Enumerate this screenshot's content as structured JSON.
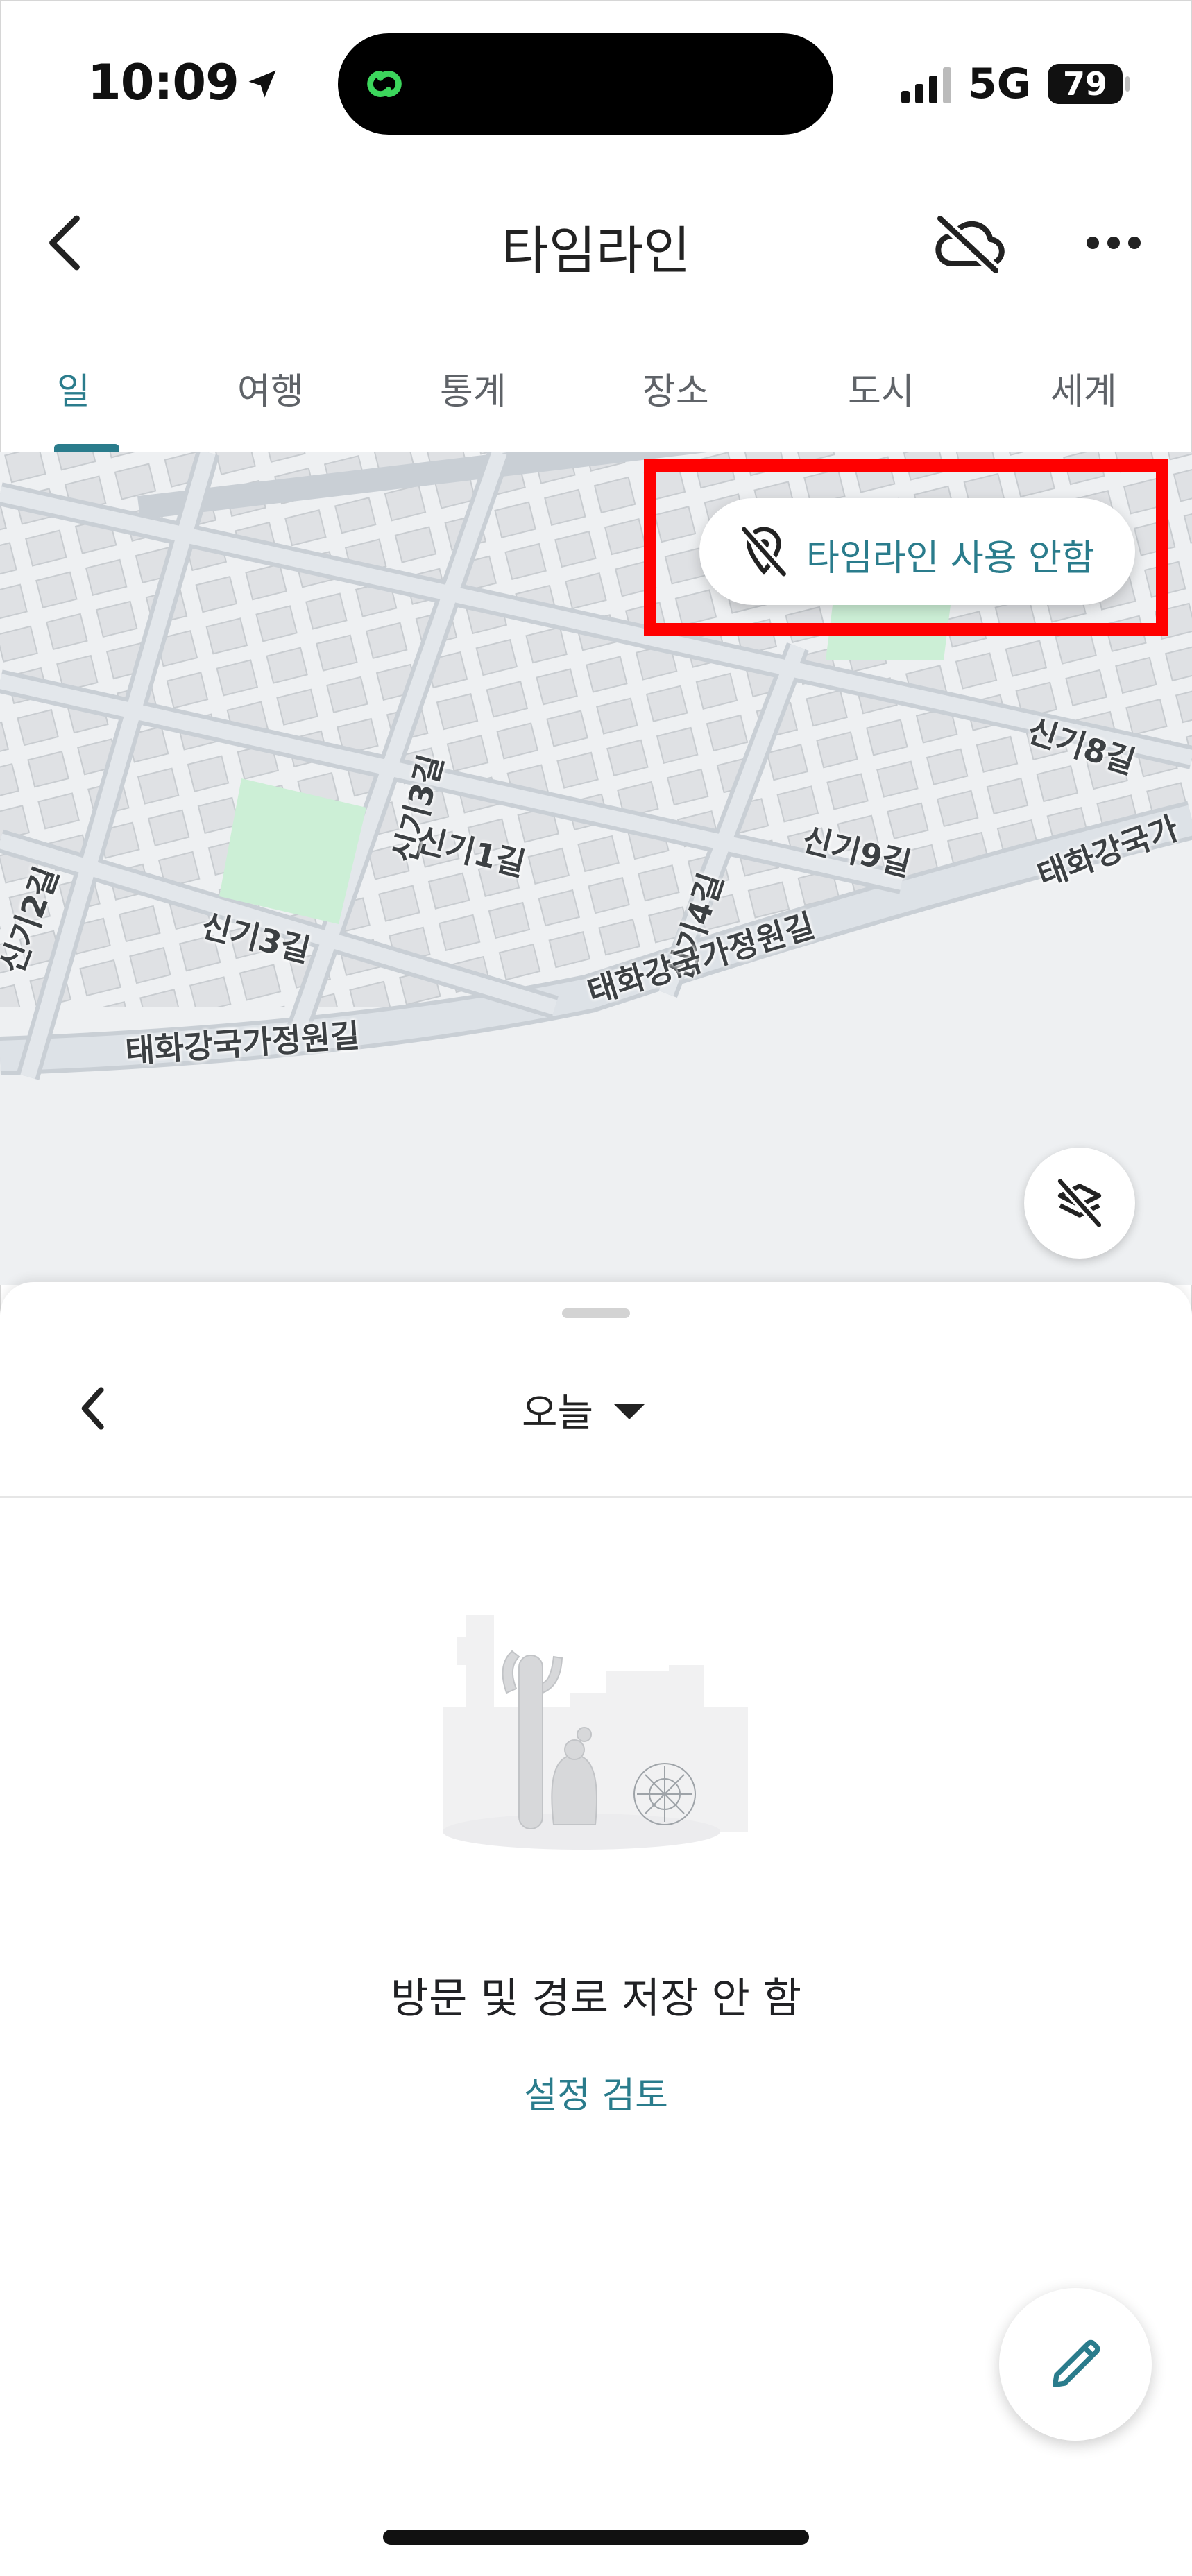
{
  "status_bar": {
    "time": "10:09",
    "network": "5G",
    "battery": "79"
  },
  "app_bar": {
    "title": "타임라인"
  },
  "tabs": [
    {
      "label": "일",
      "active": true
    },
    {
      "label": "여행",
      "active": false
    },
    {
      "label": "통계",
      "active": false
    },
    {
      "label": "장소",
      "active": false
    },
    {
      "label": "도시",
      "active": false
    },
    {
      "label": "세계",
      "active": false
    }
  ],
  "map": {
    "streets": [
      "신기3길",
      "신기1길",
      "신기4길",
      "신기8길",
      "신기9길",
      "신기2길",
      "신기3길",
      "태화강국가정원길",
      "태화강국가정원길",
      "태화강국가"
    ],
    "timeline_pill": "타임라인 사용 안함"
  },
  "sheet": {
    "day_label": "오늘",
    "empty_title": "방문 및 경로 저장 안 함",
    "review_link": "설정 검토"
  },
  "colors": {
    "accent": "#2a7c8c",
    "highlight": "#ff0000",
    "map_bg": "#eef0f2",
    "park": "#ccefd6"
  },
  "icons": [
    "location-arrow-icon",
    "cloud-off-icon",
    "more-icon",
    "back-icon",
    "timeline-off-icon",
    "layers-off-icon",
    "dropdown-icon",
    "edit-icon"
  ]
}
